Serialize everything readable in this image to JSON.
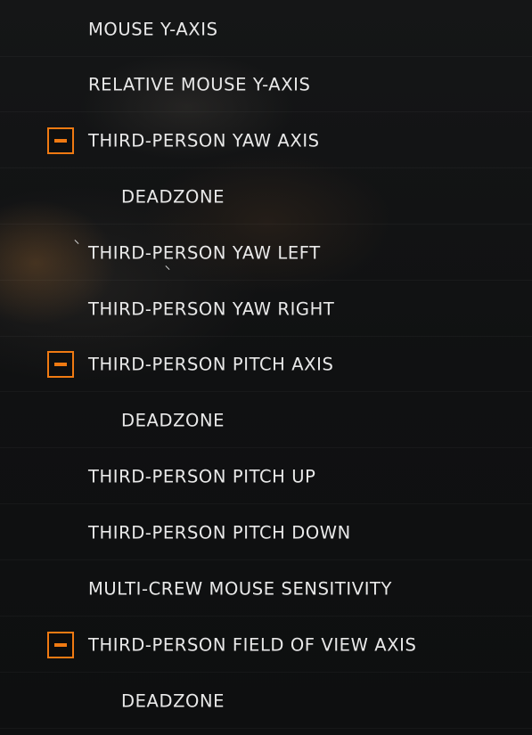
{
  "bindings": {
    "items": [
      {
        "label": "MOUSE Y-AXIS",
        "collapsible": false,
        "indent": false
      },
      {
        "label": "RELATIVE MOUSE Y-AXIS",
        "collapsible": false,
        "indent": false
      },
      {
        "label": "THIRD-PERSON YAW AXIS",
        "collapsible": true,
        "indent": false
      },
      {
        "label": "DEADZONE",
        "collapsible": false,
        "indent": true
      },
      {
        "label": "THIRD-PERSON YAW LEFT",
        "collapsible": false,
        "indent": false
      },
      {
        "label": "THIRD-PERSON YAW RIGHT",
        "collapsible": false,
        "indent": false
      },
      {
        "label": "THIRD-PERSON PITCH AXIS",
        "collapsible": true,
        "indent": false
      },
      {
        "label": "DEADZONE",
        "collapsible": false,
        "indent": true
      },
      {
        "label": "THIRD-PERSON PITCH UP",
        "collapsible": false,
        "indent": false
      },
      {
        "label": "THIRD-PERSON PITCH DOWN",
        "collapsible": false,
        "indent": false
      },
      {
        "label": "MULTI-CREW MOUSE SENSITIVITY",
        "collapsible": false,
        "indent": false
      },
      {
        "label": "THIRD-PERSON FIELD OF VIEW AXIS",
        "collapsible": true,
        "indent": false
      },
      {
        "label": "DEADZONE",
        "collapsible": false,
        "indent": true
      }
    ]
  },
  "colors": {
    "accent": "#f07a12",
    "text": "#e9e9e9",
    "background": "#111213"
  },
  "icons": {
    "collapse": "minus-box-icon"
  }
}
